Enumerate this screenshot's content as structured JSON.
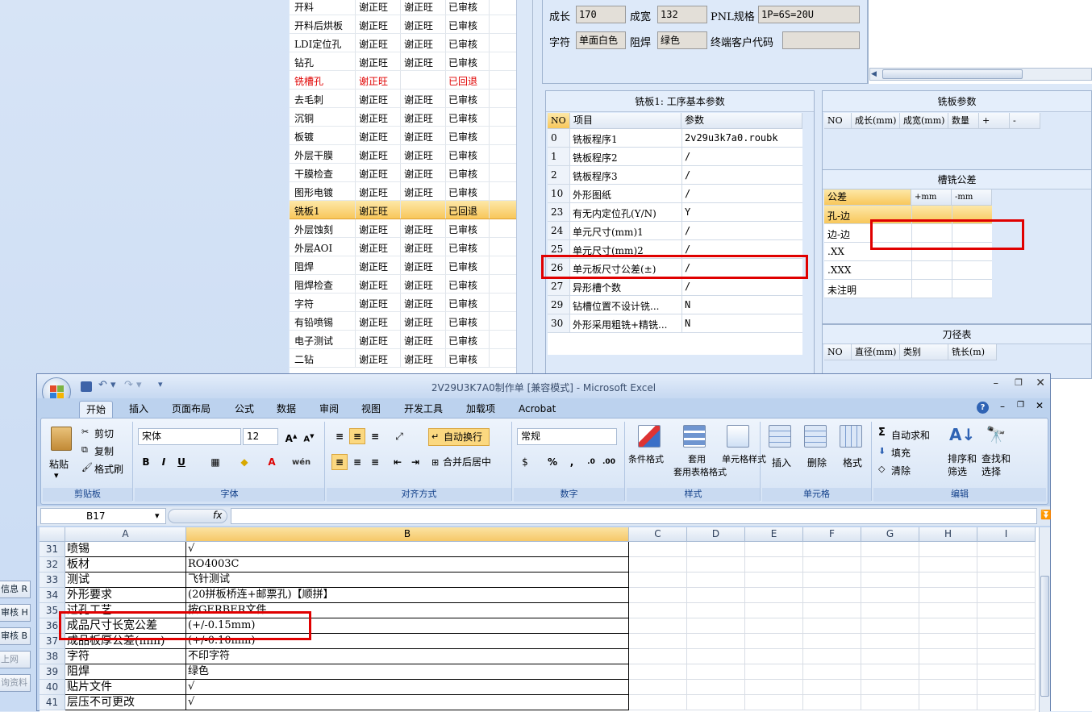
{
  "left_buttons": [
    {
      "label": "信息 R",
      "disabled": false
    },
    {
      "label": "审核 H",
      "disabled": false
    },
    {
      "label": "审核 B",
      "disabled": false
    },
    {
      "label": "上网",
      "disabled": true
    },
    {
      "label": "询资料",
      "disabled": true
    }
  ],
  "process_list": [
    {
      "name": "开料",
      "op1": "谢正旺",
      "op2": "谢正旺",
      "status": "已审核",
      "style": "normal"
    },
    {
      "name": "开料后烘板",
      "op1": "谢正旺",
      "op2": "谢正旺",
      "status": "已审核",
      "style": "normal"
    },
    {
      "name": "LDI定位孔",
      "op1": "谢正旺",
      "op2": "谢正旺",
      "status": "已审核",
      "style": "normal"
    },
    {
      "name": "钻孔",
      "op1": "谢正旺",
      "op2": "谢正旺",
      "status": "已审核",
      "style": "normal"
    },
    {
      "name": "铣槽孔",
      "op1": "谢正旺",
      "op2": "",
      "status": "已回退",
      "style": "red"
    },
    {
      "name": "去毛刺",
      "op1": "谢正旺",
      "op2": "谢正旺",
      "status": "已审核",
      "style": "normal"
    },
    {
      "name": "沉铜",
      "op1": "谢正旺",
      "op2": "谢正旺",
      "status": "已审核",
      "style": "normal"
    },
    {
      "name": "板镀",
      "op1": "谢正旺",
      "op2": "谢正旺",
      "status": "已审核",
      "style": "normal"
    },
    {
      "name": "外层干膜",
      "op1": "谢正旺",
      "op2": "谢正旺",
      "status": "已审核",
      "style": "normal"
    },
    {
      "name": "干膜检查",
      "op1": "谢正旺",
      "op2": "谢正旺",
      "status": "已审核",
      "style": "normal"
    },
    {
      "name": "图形电镀",
      "op1": "谢正旺",
      "op2": "谢正旺",
      "status": "已审核",
      "style": "normal"
    },
    {
      "name": "铣板1",
      "op1": "谢正旺",
      "op2": "",
      "status": "已回退",
      "style": "selected"
    },
    {
      "name": "外层蚀刻",
      "op1": "谢正旺",
      "op2": "谢正旺",
      "status": "已审核",
      "style": "normal"
    },
    {
      "name": "外层AOI",
      "op1": "谢正旺",
      "op2": "谢正旺",
      "status": "已审核",
      "style": "normal"
    },
    {
      "name": "阻焊",
      "op1": "谢正旺",
      "op2": "谢正旺",
      "status": "已审核",
      "style": "normal"
    },
    {
      "name": "阻焊检查",
      "op1": "谢正旺",
      "op2": "谢正旺",
      "status": "已审核",
      "style": "normal"
    },
    {
      "name": "字符",
      "op1": "谢正旺",
      "op2": "谢正旺",
      "status": "已审核",
      "style": "normal"
    },
    {
      "name": "有铅喷锡",
      "op1": "谢正旺",
      "op2": "谢正旺",
      "status": "已审核",
      "style": "normal"
    },
    {
      "name": "电子测试",
      "op1": "谢正旺",
      "op2": "谢正旺",
      "status": "已审核",
      "style": "normal"
    },
    {
      "name": "二钻",
      "op1": "谢正旺",
      "op2": "谢正旺",
      "status": "已审核",
      "style": "normal"
    }
  ],
  "info": {
    "length_label": "成长",
    "length_value": "170",
    "width_label": "成宽",
    "width_value": "132",
    "pnl_label": "PNL规格",
    "pnl_value": "1P=6S=20U",
    "char_label": "字符",
    "char_value": "单面白色",
    "mask_label": "阻焊",
    "mask_value": "绿色",
    "customer_label": "终端客户代码",
    "customer_value": ""
  },
  "basic_params": {
    "title": "铣板1: 工序基本参数",
    "headers": [
      "NO",
      "项目",
      "参数"
    ],
    "rows": [
      {
        "no": "0",
        "item": "铣板程序1",
        "value": "2v29u3k7a0.roubk"
      },
      {
        "no": "1",
        "item": "铣板程序2",
        "value": "/"
      },
      {
        "no": "2",
        "item": "铣板程序3",
        "value": "/"
      },
      {
        "no": "10",
        "item": "外形图纸",
        "value": "/"
      },
      {
        "no": "23",
        "item": "有无内定位孔(Y/N)",
        "value": "Y"
      },
      {
        "no": "24",
        "item": "单元尺寸(mm)1",
        "value": "/"
      },
      {
        "no": "25",
        "item": "单元尺寸(mm)2",
        "value": "/"
      },
      {
        "no": "26",
        "item": "单元板尺寸公差(±)",
        "value": "/"
      },
      {
        "no": "27",
        "item": "异形槽个数",
        "value": "/"
      },
      {
        "no": "29",
        "item": "钻槽位置不设计铣...",
        "value": "N"
      },
      {
        "no": "30",
        "item": "外形采用粗铣+精铣...",
        "value": "N"
      }
    ]
  },
  "board_params": {
    "title": "铣板参数",
    "headers": [
      "NO",
      "成长(mm)",
      "成宽(mm)",
      "数量",
      "+",
      "-"
    ]
  },
  "slot_tolerance": {
    "title": "槽铣公差",
    "headers": [
      "公差",
      "+mm",
      "-mm"
    ],
    "rows": [
      "孔-边",
      "边-边",
      ".XX",
      ".XXX",
      "未注明"
    ]
  },
  "tool_table": {
    "title": "刀径表",
    "headers": [
      "NO",
      "直径(mm)",
      "类别",
      "铣长(m)"
    ]
  },
  "excel": {
    "title": "2V29U3K7A0制作单 [兼容模式] - Microsoft Excel",
    "tabs": [
      "开始",
      "插入",
      "页面布局",
      "公式",
      "数据",
      "审阅",
      "视图",
      "开发工具",
      "加载项",
      "Acrobat"
    ],
    "clipboard": {
      "paste": "粘贴",
      "cut": "剪切",
      "copy": "复制",
      "format_painter": "格式刷",
      "label": "剪贴板"
    },
    "font": {
      "name": "宋体",
      "size": "12",
      "label": "字体"
    },
    "align": {
      "wrap": "自动换行",
      "merge": "合并后居中",
      "label": "对齐方式"
    },
    "number": {
      "format": "常规",
      "label": "数字"
    },
    "styles": {
      "cond": "条件格式",
      "table": "套用表格格式",
      "cell": "单元格样式",
      "label": "样式"
    },
    "cells": {
      "insert": "插入",
      "delete": "删除",
      "format": "格式",
      "label": "单元格"
    },
    "editing": {
      "autosum": "自动求和",
      "fill": "填充",
      "clear": "清除",
      "sort": "排序和筛选",
      "find": "查找和选择",
      "label": "编辑"
    },
    "name_box": "B17",
    "fx": "fx",
    "columns": [
      "A",
      "B",
      "C",
      "D",
      "E",
      "F",
      "G",
      "H",
      "I"
    ],
    "rows": [
      {
        "n": "31",
        "a": "喷锡",
        "b": "√"
      },
      {
        "n": "32",
        "a": "板材",
        "b": "RO4003C"
      },
      {
        "n": "33",
        "a": "测试",
        "b": "飞针测试"
      },
      {
        "n": "34",
        "a": "外形要求",
        "b": "(20拼板桥连+邮票孔)【顺拼】"
      },
      {
        "n": "35",
        "a": "过孔工艺",
        "b": "按GERBER文件"
      },
      {
        "n": "36",
        "a": "成品尺寸长宽公差",
        "b": "(+/-0.15mm)"
      },
      {
        "n": "37",
        "a": "成品板厚公差(mm)",
        "b": "(+/-0.10mm)"
      },
      {
        "n": "38",
        "a": "字符",
        "b": "不印字符"
      },
      {
        "n": "39",
        "a": "阻焊",
        "b": "绿色"
      },
      {
        "n": "40",
        "a": "贴片文件",
        "b": "√"
      },
      {
        "n": "41",
        "a": "层压不可更改",
        "b": "√"
      }
    ]
  },
  "colors": {
    "highlight": "#e00000",
    "selected_row": "#f8c75b",
    "ribbon_text": "#15428b"
  }
}
